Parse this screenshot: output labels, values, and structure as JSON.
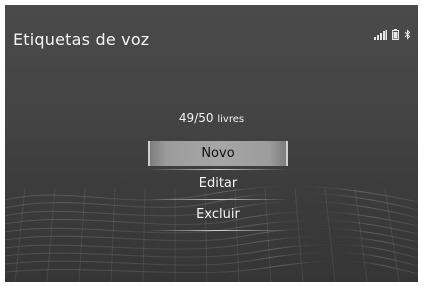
{
  "header": {
    "title": "Etiquetas de voz",
    "status_icons": [
      "signal-strength-icon",
      "battery-icon",
      "bluetooth-icon"
    ]
  },
  "status": {
    "count": "49/50",
    "count_suffix": "livres"
  },
  "menu": {
    "items": [
      {
        "label": "Novo",
        "selected": true
      },
      {
        "label": "Editar",
        "selected": false
      },
      {
        "label": "Excluir",
        "selected": false
      }
    ]
  },
  "colors": {
    "background": "#444444",
    "text": "#f4f4f4",
    "selected_background": "#a6a6a6",
    "selected_text": "#111111"
  }
}
